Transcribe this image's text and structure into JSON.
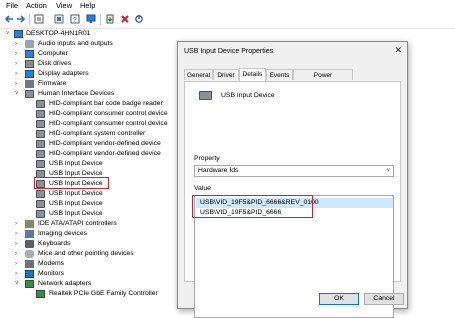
{
  "menu": [
    "File",
    "Action",
    "View",
    "Help"
  ],
  "toolbar": {
    "buttons": [
      "back-icon",
      "forward-icon",
      "properties-icon",
      "show-hidden-icon",
      "help-icon",
      "monitor-icon",
      "update-driver-icon",
      "disable-icon",
      "uninstall-icon"
    ]
  },
  "tree": {
    "root": "DESKTOP-4HN1R01",
    "items": [
      {
        "label": "Audio inputs and outputs",
        "expanded": false
      },
      {
        "label": "Computer",
        "expanded": false
      },
      {
        "label": "Disk drives",
        "expanded": false
      },
      {
        "label": "Display adapters",
        "expanded": false
      },
      {
        "label": "Firmware",
        "expanded": false
      },
      {
        "label": "Human Interface Devices",
        "expanded": true
      },
      {
        "label": "HID-compliant bar code badge reader",
        "child": true
      },
      {
        "label": "HID-compliant consumer control device",
        "child": true
      },
      {
        "label": "HID-compliant consumer control device",
        "child": true
      },
      {
        "label": "HID-compliant system controller",
        "child": true
      },
      {
        "label": "HID-compliant vendor-defined device",
        "child": true
      },
      {
        "label": "HID-compliant vendor-defined device",
        "child": true
      },
      {
        "label": "USB Input Device",
        "child": true
      },
      {
        "label": "USB Input Device",
        "child": true,
        "highlighted": true
      },
      {
        "label": "USB Input Device",
        "child": true
      },
      {
        "label": "USB Input Device",
        "child": true
      },
      {
        "label": "USB Input Device",
        "child": true
      },
      {
        "label": "USB Input Device",
        "child": true
      },
      {
        "label": "IDE ATA/ATAPI controllers",
        "expanded": false
      },
      {
        "label": "Imaging devices",
        "expanded": false
      },
      {
        "label": "Keyboards",
        "expanded": false
      },
      {
        "label": "Mice and other pointing devices",
        "expanded": false
      },
      {
        "label": "Modems",
        "expanded": false
      },
      {
        "label": "Monitors",
        "expanded": false
      },
      {
        "label": "Network adapters",
        "expanded": true
      },
      {
        "label": "Realtek PCIe GbE Family Controller",
        "child": true
      }
    ]
  },
  "dialog": {
    "title": "USB Input Device Properties",
    "close_label": "✕",
    "tabs": [
      "General",
      "Driver",
      "Details",
      "Events",
      "Power Management"
    ],
    "active_tab": "Details",
    "device_name": "USB Input Device",
    "property_label": "Property",
    "property_value": "Hardware Ids",
    "value_label": "Value",
    "values": [
      "USB\\VID_19F5&PID_6666&REV_0100",
      "USB\\VID_19F5&PID_6666"
    ],
    "ok_label": "OK",
    "cancel_label": "Cancel"
  },
  "colors": {
    "highlight_border": "#d61f2c",
    "selection": "#cde8ff",
    "accent": "#0078d7"
  }
}
